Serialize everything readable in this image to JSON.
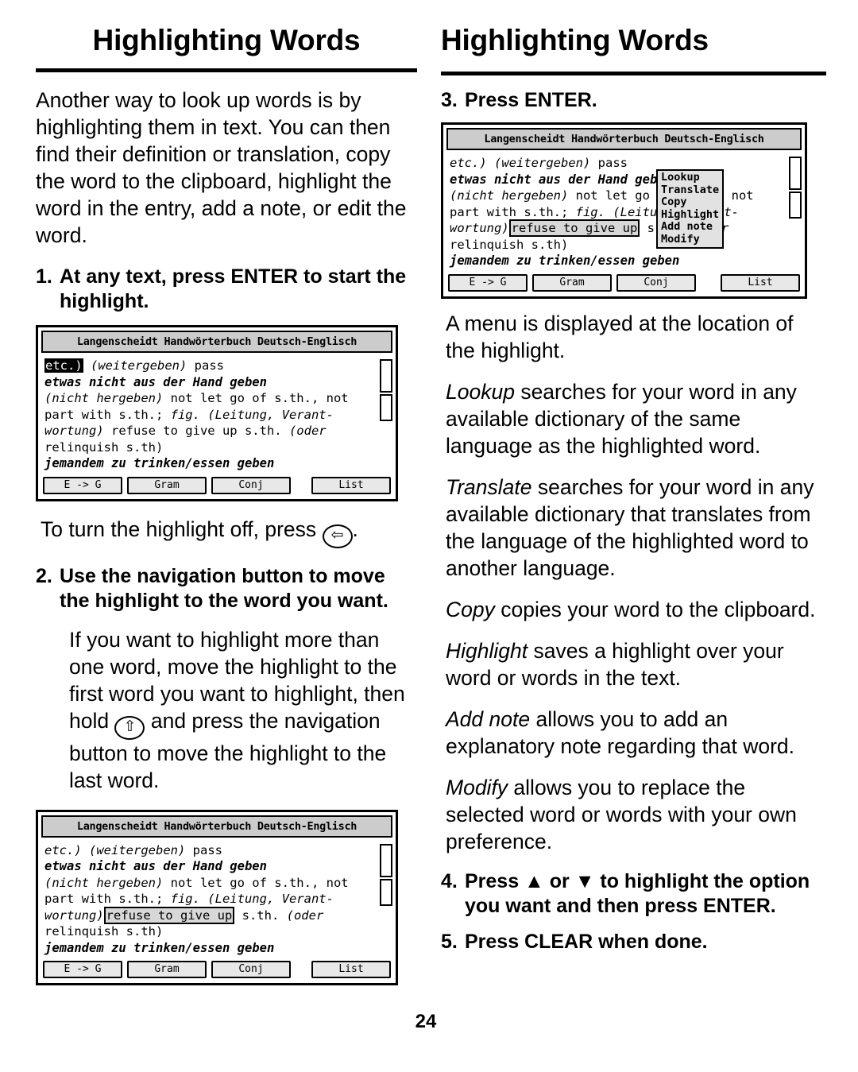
{
  "page": {
    "number": "24",
    "left_title": "Highlighting Words",
    "right_title": "Highlighting Words"
  },
  "left": {
    "intro": "Another way to look up words is by highlighting them in text. You can then find their definition or translation, copy the word to the clipboard, highlight the word in the entry, add a note, or edit the word.",
    "step1": {
      "num": "1.",
      "text": "At any text, press ENTER to start the highlight."
    },
    "after_fig1_pre": "To turn the highlight off, press",
    "after_fig1_key": "⇦",
    "after_fig1_post": ".",
    "step2": {
      "num": "2.",
      "text": "Use the navigation button to move the highlight to the word you want."
    },
    "step2_body_pre": "If you want to highlight more than one word, move the highlight to the first word you want to highlight, then hold",
    "step2_key": "⇧",
    "step2_body_post": "and press the navigation button to move the highlight to the last word."
  },
  "right": {
    "step3": {
      "num": "3.",
      "text": "Press ENTER."
    },
    "menu_note": "A menu is displayed at the location of the highlight.",
    "lookup_label": "Lookup",
    "lookup_text": " searches for your word in any available dictionary of the same language as the highlighted word.",
    "translate_label": "Translate",
    "translate_text": " searches for your word in any available dictionary that translates from the language of the highlighted word to another language.",
    "copy_label": "Copy",
    "copy_text": " copies your word to the clipboard.",
    "highlight_label": "Highlight",
    "highlight_text": " saves a highlight over your word or words in the text.",
    "addnote_label": "Add note",
    "addnote_text": " allows you to add an explanatory note regarding that word.",
    "modify_label": "Modify",
    "modify_text": " allows you to replace the selected word or words with your own preference.",
    "step4": {
      "num": "4.",
      "text": "Press ▲ or ▼ to highlight the option you want and then press ENTER."
    },
    "step5": {
      "num": "5.",
      "text": "Press CLEAR when done."
    }
  },
  "device": {
    "titlebar": "Langenscheidt Handwörterbuch Deutsch-Englisch",
    "buttons": {
      "eg": "E -> G",
      "gram": "Gram",
      "conj": "Conj",
      "list": "List"
    },
    "lines": {
      "l1_a": "etc.)",
      "l1_b": " (weitergeben)",
      "l1_c": " pass",
      "l2": "etwas nicht aus der Hand geben",
      "l3_a": "(nicht hergeben)",
      "l3_b": " not let go of s.th., not",
      "l4_a": "part with s.th.; ",
      "l4_b": "fig. (Leitung, Verant-",
      "l5_a": "wortung)",
      "l5_b": " refuse to give up",
      "l5_c": " s.th. ",
      "l5_d": "(oder",
      "l6": "relinquish s.th)",
      "l7": "jemandem zu trinken/essen geben"
    },
    "fig1_highlight": "etc.)",
    "fig2_highlight": "refuse to give up",
    "popup": {
      "items": [
        "Lookup",
        "Translate",
        "Copy",
        "Highlight",
        "Add note",
        "Modify"
      ]
    }
  }
}
